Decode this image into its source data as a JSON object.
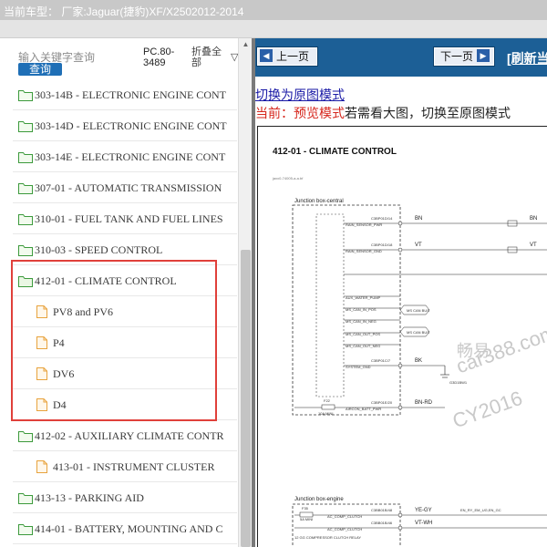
{
  "header": {
    "vehicle": "当前车型：   厂家:Jaguar(捷豹)XF/X2502012-2014"
  },
  "search": {
    "hint": "输入关键字查询",
    "query_button": "查询",
    "pc_code": "PC.80-3489",
    "collapse_label": "折叠全部"
  },
  "tree": [
    {
      "label": "303-14B - ELECTRONIC ENGINE CONT",
      "type": "folder"
    },
    {
      "label": "303-14D - ELECTRONIC ENGINE CONT",
      "type": "folder"
    },
    {
      "label": "303-14E - ELECTRONIC ENGINE CONT",
      "type": "folder"
    },
    {
      "label": "307-01 - AUTOMATIC TRANSMISSION",
      "type": "folder"
    },
    {
      "label": "310-01 - FUEL TANK AND FUEL LINES",
      "type": "folder"
    },
    {
      "label": "310-03 - SPEED CONTROL",
      "type": "folder"
    },
    {
      "label": "412-01 - CLIMATE CONTROL",
      "type": "folder-open"
    },
    {
      "label": "PV8 and PV6",
      "type": "doc"
    },
    {
      "label": "P4",
      "type": "doc"
    },
    {
      "label": "DV6",
      "type": "doc"
    },
    {
      "label": "D4",
      "type": "doc"
    },
    {
      "label": "412-02 - AUXILIARY CLIMATE CONTR",
      "type": "folder"
    },
    {
      "label": "413-01 - INSTRUMENT CLUSTER",
      "type": "doc-indented"
    },
    {
      "label": "413-13 - PARKING AID",
      "type": "folder"
    },
    {
      "label": "414-01 - BATTERY, MOUNTING AND C",
      "type": "folder"
    }
  ],
  "nav": {
    "prev": "上一页",
    "next": "下一页",
    "refresh": "[刷新当"
  },
  "mode": {
    "link": "切换为原图模式",
    "status_prefix": "当前：预览模式",
    "status_rest": "若需看大图，切换至原图模式"
  },
  "document": {
    "title": "412-01 - CLIMATE CONTROL",
    "subtitle": "jaxx0-74005-a-a.bf",
    "box1_label": "Junction box-central",
    "box2_label": "Junction box-engine",
    "wire_bn": "BN",
    "wire_vt": "VT",
    "wire_bk": "BK",
    "wire_bnrd": "BN-RD",
    "wire_yegy": "YE-GY",
    "wire_vtwh": "VT-WH",
    "fuse_f22": "F22",
    "fuse_f35": "F35",
    "conn_top1": "C3BP01D/14",
    "conn_top2": "C3BP01D/18",
    "conn_mid": "C3BP01C/7",
    "conn_bot": "C3BP01E/20",
    "conn_eng1": "C3BB01B/48",
    "conn_eng2": "C3BB01B/46",
    "sig_rain_pwr": "RAIN_SENSOR_PWR",
    "sig_rain_gnd": "RAIN_SENSOR_GND",
    "sig_aux_pump": "AUX_WATER_PUMP",
    "sig_can_in_pos": "MS_CAN_IN_POS",
    "sig_can_in_neg": "MS_CAN_IN_NEG",
    "sig_can_out_pos": "MS_CAN_OUT_POS",
    "sig_can_out_neg": "MS_CAN_OUT_NEG",
    "sig_system_gnd": "SYSTEM_GND",
    "sig_aircon_batt": "AIRCON_BATT_PWR",
    "sig_ac_clutch": "AC_COMP_CLUTCH",
    "sig_ac_clutch2": "AC_COMP_CLUTCH",
    "ecu_label": "EN_RY_EM_UG,EN_GC",
    "relay_label": "12 GG COMPRESSOR CLUTCH RELAY",
    "ground_label": "G3D1BW1",
    "fuse_rating": "10A MINI",
    "fuse_rating2": "5A MINI",
    "ms_can_tag": "MS CAN BUS",
    "watermark_cn": "畅易",
    "watermark_url": "car388.com",
    "watermark_id": "CY2016"
  }
}
